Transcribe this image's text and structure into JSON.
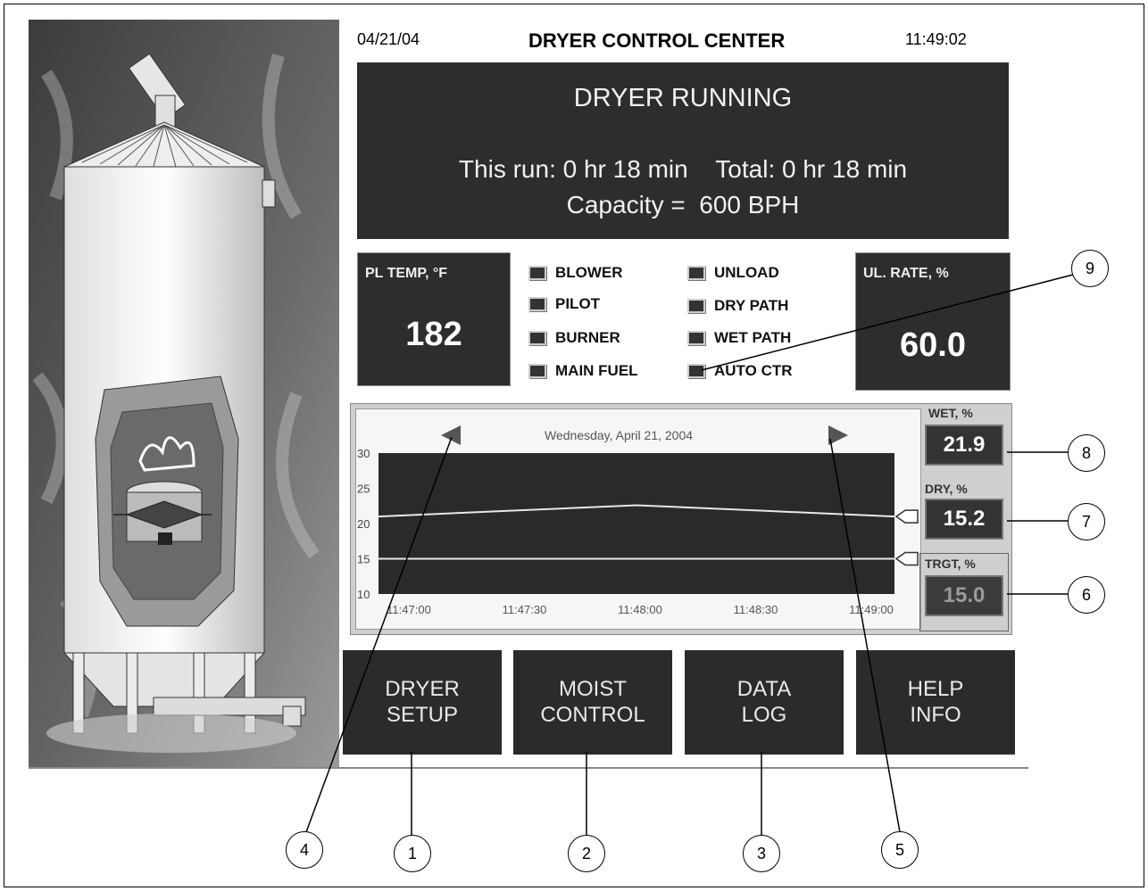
{
  "header": {
    "date": "04/21/04",
    "title": "DRYER CONTROL CENTER",
    "time": "11:49:02"
  },
  "status": {
    "state": "DRYER RUNNING",
    "run_line": "This run: 0 hr 18 min    Total: 0 hr 18 min",
    "capacity_line": "Capacity =  600 BPH"
  },
  "pl_temp": {
    "label": "PL TEMP, °F",
    "value": "182"
  },
  "ul_rate": {
    "label": "UL. RATE, %",
    "value": "60.0"
  },
  "indicators_left": [
    "BLOWER",
    "PILOT",
    "BURNER",
    "MAIN FUEL"
  ],
  "indicators_right": [
    "UNLOAD",
    "DRY PATH",
    "WET PATH",
    "AUTO CTR"
  ],
  "chart": {
    "date": "Wednesday, April 21, 2004",
    "prev_icon": "arrow-left-icon",
    "next_icon": "arrow-right-icon"
  },
  "chart_data": {
    "type": "line",
    "x": [
      "11:47:00",
      "11:47:30",
      "11:48:00",
      "11:48:30",
      "11:49:00"
    ],
    "yticks": [
      30,
      25,
      20,
      15,
      10
    ],
    "ylim": [
      10,
      30
    ],
    "series": [
      {
        "values": [
          21.0,
          21.8,
          22.6,
          21.8,
          21.0
        ]
      },
      {
        "values": [
          15.0,
          15.0,
          15.0,
          15.0,
          15.0
        ]
      }
    ]
  },
  "readouts": {
    "wet": {
      "label": "WET, %",
      "value": "21.9"
    },
    "dry": {
      "label": "DRY, %",
      "value": "15.2"
    },
    "trgt": {
      "label": "TRGT, %",
      "value": "15.0"
    }
  },
  "buttons": [
    {
      "line1": "DRYER",
      "line2": "SETUP"
    },
    {
      "line1": "MOIST",
      "line2": "CONTROL"
    },
    {
      "line1": "DATA",
      "line2": "LOG"
    },
    {
      "line1": "HELP",
      "line2": "INFO"
    }
  ],
  "callouts": [
    "1",
    "2",
    "3",
    "4",
    "5",
    "6",
    "7",
    "8",
    "9"
  ],
  "colors": {
    "panel": "#2d2d2d",
    "plot_bg": "#2a2a2a",
    "trace": "#e8e8e8"
  }
}
